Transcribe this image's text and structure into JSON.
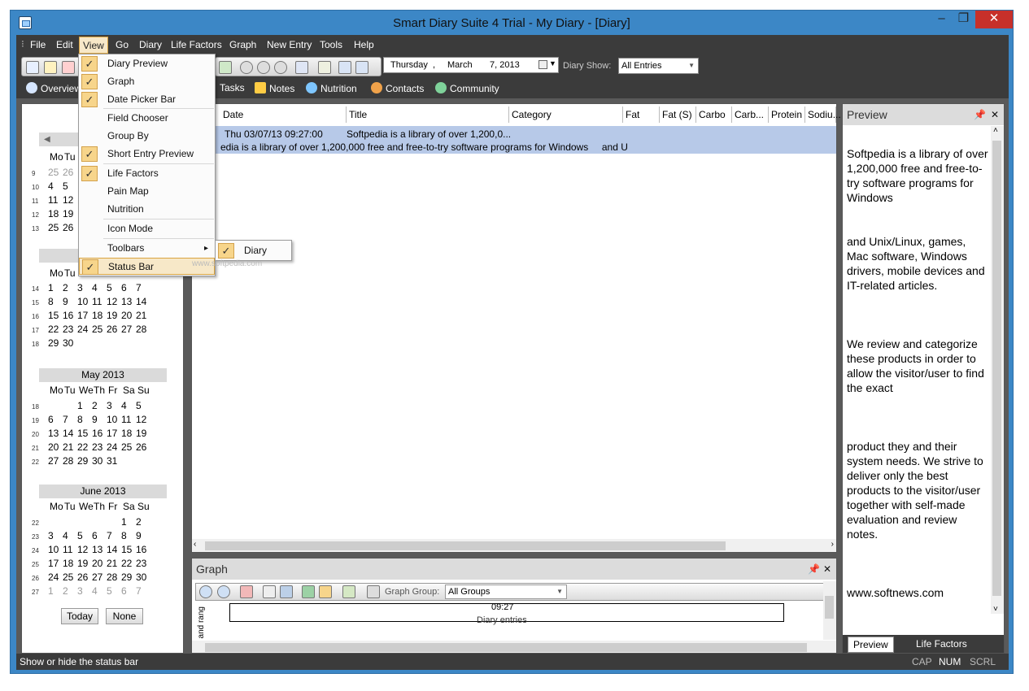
{
  "window": {
    "title": "Smart Diary Suite 4 Trial - My Diary - [Diary]"
  },
  "menu": [
    "File",
    "Edit",
    "View",
    "Go",
    "Diary",
    "Life Factors",
    "Graph",
    "New Entry",
    "Tools",
    "Help"
  ],
  "toolbar": {
    "date_weekday": "Thursday",
    "date_month": "March",
    "date_day": "7, 2013",
    "diary_show_label": "Diary Show:",
    "diary_show_value": "All Entries"
  },
  "nav": [
    "Overview",
    "Tasks",
    "Notes",
    "Nutrition",
    "Contacts",
    "Community"
  ],
  "view_menu": {
    "items": [
      {
        "label": "Diary Preview",
        "checked": true
      },
      {
        "label": "Graph",
        "checked": true
      },
      {
        "label": "Date Picker Bar",
        "checked": true
      },
      {
        "label": "Field Chooser",
        "checked": false
      },
      {
        "label": "Group By",
        "checked": false
      },
      {
        "label": "Short Entry Preview",
        "checked": true
      },
      {
        "label": "Life Factors",
        "checked": true
      },
      {
        "label": "Pain Map",
        "checked": false
      },
      {
        "label": "Nutrition",
        "checked": false
      },
      {
        "label": "Icon Mode",
        "checked": false
      },
      {
        "label": "Toolbars",
        "checked": false
      },
      {
        "label": "Status Bar",
        "checked": true
      }
    ],
    "toolbars_submenu": {
      "label": "Diary",
      "checked": true
    },
    "watermark": "www.softpedia.com"
  },
  "calendar": {
    "day_headers": [
      "Mo",
      "Tu",
      "We",
      "Th",
      "Fr",
      "Sa",
      "Su"
    ],
    "march_rows": [
      {
        "wk": "9",
        "days": [
          "25",
          "26"
        ]
      },
      {
        "wk": "10",
        "days": [
          "4",
          "5"
        ]
      },
      {
        "wk": "11",
        "days": [
          "11",
          "12"
        ]
      },
      {
        "wk": "12",
        "days": [
          "18",
          "19"
        ]
      },
      {
        "wk": "13",
        "days": [
          "25",
          "26"
        ]
      }
    ],
    "april_rows": [
      {
        "wk": "14",
        "days": [
          "1",
          "2",
          "3",
          "4",
          "5",
          "6",
          "7"
        ]
      },
      {
        "wk": "15",
        "days": [
          "8",
          "9",
          "10",
          "11",
          "12",
          "13",
          "14"
        ]
      },
      {
        "wk": "16",
        "days": [
          "15",
          "16",
          "17",
          "18",
          "19",
          "20",
          "21"
        ]
      },
      {
        "wk": "17",
        "days": [
          "22",
          "23",
          "24",
          "25",
          "26",
          "27",
          "28"
        ]
      },
      {
        "wk": "18",
        "days": [
          "29",
          "30",
          "",
          "",
          "",
          "",
          ""
        ]
      }
    ],
    "may_title": "May 2013",
    "may_rows": [
      {
        "wk": "18",
        "days": [
          "",
          "",
          "1",
          "2",
          "3",
          "4",
          "5"
        ]
      },
      {
        "wk": "19",
        "days": [
          "6",
          "7",
          "8",
          "9",
          "10",
          "11",
          "12"
        ]
      },
      {
        "wk": "20",
        "days": [
          "13",
          "14",
          "15",
          "16",
          "17",
          "18",
          "19"
        ]
      },
      {
        "wk": "21",
        "days": [
          "20",
          "21",
          "22",
          "23",
          "24",
          "25",
          "26"
        ]
      },
      {
        "wk": "22",
        "days": [
          "27",
          "28",
          "29",
          "30",
          "31",
          "",
          ""
        ]
      }
    ],
    "june_title": "June 2013",
    "june_rows": [
      {
        "wk": "22",
        "days": [
          "",
          "",
          "",
          "",
          "",
          "1",
          "2"
        ]
      },
      {
        "wk": "23",
        "days": [
          "3",
          "4",
          "5",
          "6",
          "7",
          "8",
          "9"
        ]
      },
      {
        "wk": "24",
        "days": [
          "10",
          "11",
          "12",
          "13",
          "14",
          "15",
          "16"
        ]
      },
      {
        "wk": "25",
        "days": [
          "17",
          "18",
          "19",
          "20",
          "21",
          "22",
          "23"
        ]
      },
      {
        "wk": "26",
        "days": [
          "24",
          "25",
          "26",
          "27",
          "28",
          "29",
          "30"
        ]
      },
      {
        "wk": "27",
        "days": [
          "1",
          "2",
          "3",
          "4",
          "5",
          "6",
          "7"
        ]
      }
    ],
    "today_label": "Today",
    "none_label": "None"
  },
  "grid": {
    "columns": [
      "Date",
      "Title",
      "Category",
      "Fat",
      "Fat (S)",
      "Carbo",
      "Carb...",
      "Protein",
      "Sodiu..."
    ],
    "row_date": "Thu 03/07/13 09:27:00",
    "row_title": "Softpedia is a library of over 1,200,0...",
    "row_preview": "edia is a library of over 1,200,000 free and free-to-try software programs for Windows     and U"
  },
  "graph": {
    "title": "Graph",
    "group_label": "Graph Group:",
    "group_value": "All Groups",
    "time_label": "09:27",
    "axis_label": "Diary entries",
    "y_label": "and rang"
  },
  "preview": {
    "title": "Preview",
    "paragraphs": [
      "Softpedia is a library of over 1,200,000 free and free-to-try software programs for Windows",
      "and Unix/Linux, games, Mac software, Windows drivers, mobile devices and IT-related articles.",
      "We review and categorize these products in order to allow the visitor/user to find the exact",
      "product they and their system needs. We strive to deliver only the best products to the visitor/user together with self-made evaluation and review notes.",
      "www.softnews.com"
    ],
    "tab_preview": "Preview",
    "tab_life_factors": "Life Factors"
  },
  "status": {
    "text": "Show or hide the status bar",
    "cap": "CAP",
    "num": "NUM",
    "scrl": "SCRL"
  }
}
